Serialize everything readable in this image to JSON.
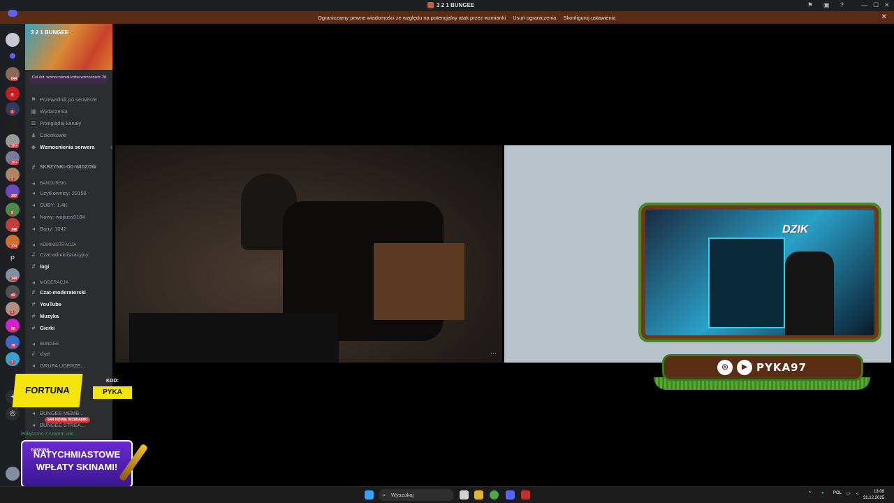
{
  "window": {
    "title": "3 2 1 BUNGEE",
    "controls": [
      "⚑",
      "▣",
      "?",
      "—",
      "☐",
      "✕"
    ]
  },
  "banner": {
    "message": "Ograniczamy pewne wiadomości ze względu na potencjalny atak przez wzmianki",
    "action1": "Usuń ograniczenia",
    "action2": "Skonfiguruj ustawienia",
    "close": "✕"
  },
  "guild_badges": [
    "644",
    "4",
    "1",
    "1K+",
    "1K+",
    "1",
    "297",
    "9",
    "348",
    "374",
    "344",
    "40",
    "1",
    "56",
    "78",
    "1"
  ],
  "server": {
    "name": "3 2 1 BUNGEE",
    "boost_goal": "Cel dot. wzmocnienia",
    "boost_count": "Liczba wzmocnień: 28"
  },
  "channels": {
    "guide": "Przewodnik po serwerze",
    "events": "Wydarzenia",
    "browse": "Przeglądaj kanały",
    "members": "Członkowie",
    "boosts": "Wzmocnienia serwera",
    "boosts_count": "3",
    "skrzynki": "SKRZYNKI-OD-WIDZÓW",
    "cat_bandurski": "BANDURSKI",
    "users": "Użytkownicy: 29156",
    "suby": "SUBY: 1.4K",
    "nowy": "Nowy: wojtuss9184",
    "bany": "Bany: 1042",
    "cat_admin": "ADMINISTRACJA",
    "czat_admin": "Czat-administracyjny",
    "logi": "logi",
    "cat_mod": "MODERACJA",
    "czat_mod": "Czat-moderatorski",
    "youtube": "YouTube",
    "muzyka": "Muzyka",
    "gierki": "Gierki",
    "cat_bungee": "BUNGEE",
    "chat": "chat",
    "grupa": "GRUPA UDERZE...",
    "bungee_memb": "BUNGEE MEMB...",
    "bungee_strea": "BUNGEE STREA..."
  },
  "notif": "644 NOWE WZMIANKI",
  "voice_status": "Połączono z czatem wid",
  "overlay": {
    "dzik": "DZIK",
    "social_handle": "PYKA97",
    "fortuna": "FORTUNA",
    "kod_label": "KOD:",
    "kod_value": "PYKA",
    "skins_brand": "G4SKINS",
    "skins_line1": "NATYCHMIASTOWE",
    "skins_line2": "WPŁATY SKINAMI!"
  },
  "stream_more": "···",
  "taskbar": {
    "search_placeholder": "Wyszukaj",
    "lang": "POL",
    "time": "13:08",
    "date": "31.12.2025"
  }
}
